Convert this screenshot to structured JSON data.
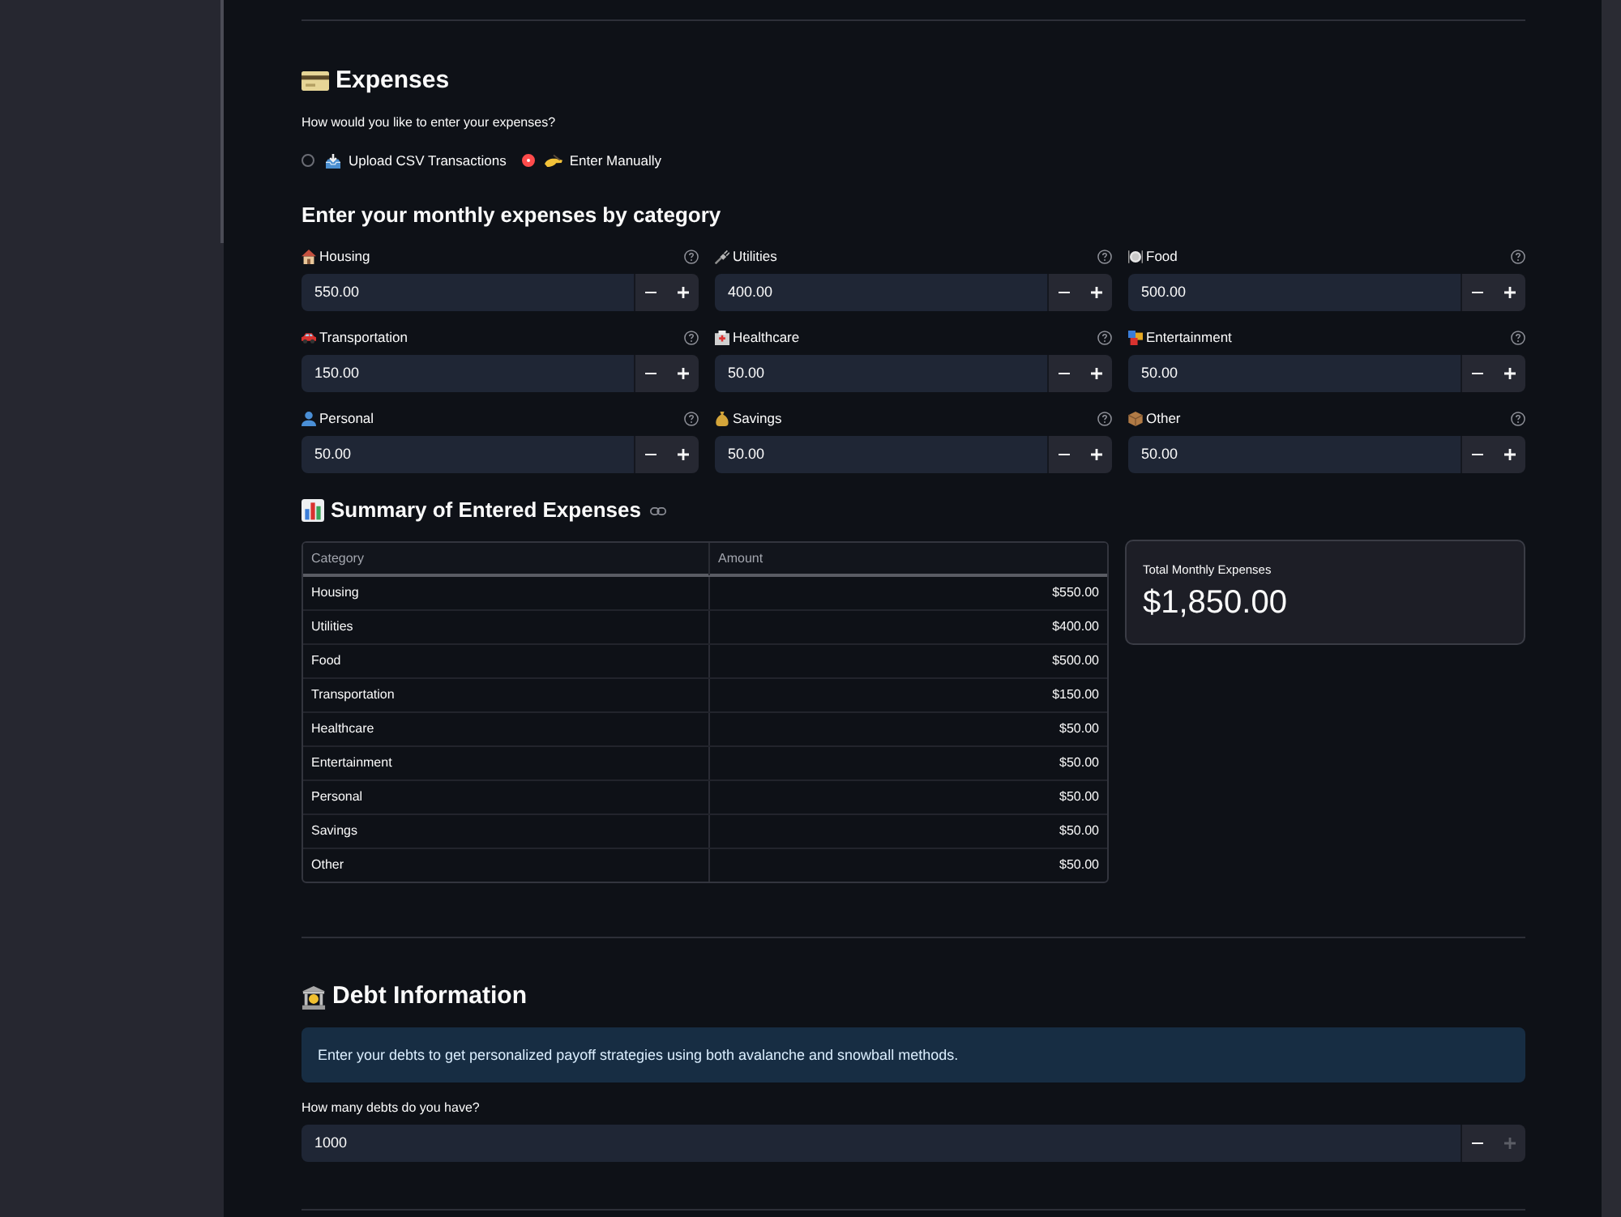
{
  "expense_entry": {
    "title": "Expenses",
    "question": "How would you like to enter your expenses?",
    "options": [
      {
        "label": "Upload CSV Transactions",
        "selected": false
      },
      {
        "label": "Enter Manually",
        "selected": true
      }
    ]
  },
  "category_inputs": {
    "title": "Enter your monthly expenses by category",
    "fields": [
      {
        "label": "Housing",
        "value": "550.00"
      },
      {
        "label": "Utilities",
        "value": "400.00"
      },
      {
        "label": "Food",
        "value": "500.00"
      },
      {
        "label": "Transportation",
        "value": "150.00"
      },
      {
        "label": "Healthcare",
        "value": "50.00"
      },
      {
        "label": "Entertainment",
        "value": "50.00"
      },
      {
        "label": "Personal",
        "value": "50.00"
      },
      {
        "label": "Savings",
        "value": "50.00"
      },
      {
        "label": "Other",
        "value": "50.00"
      }
    ]
  },
  "summary": {
    "title": "Summary of Entered Expenses",
    "table": {
      "columns": [
        "Category",
        "Amount"
      ],
      "rows": [
        [
          "Housing",
          "$550.00"
        ],
        [
          "Utilities",
          "$400.00"
        ],
        [
          "Food",
          "$500.00"
        ],
        [
          "Transportation",
          "$150.00"
        ],
        [
          "Healthcare",
          "$50.00"
        ],
        [
          "Entertainment",
          "$50.00"
        ],
        [
          "Personal",
          "$50.00"
        ],
        [
          "Savings",
          "$50.00"
        ],
        [
          "Other",
          "$50.00"
        ]
      ]
    },
    "metric": {
      "label": "Total Monthly Expenses",
      "value": "$1,850.00"
    }
  },
  "debt_section": {
    "title": "Debt Information",
    "info": "Enter your debts to get personalized payoff strategies using both avalanche and snowball methods.",
    "count_input": {
      "label": "How many debts do you have?",
      "value": "1000",
      "minus_disabled": false,
      "plus_disabled": true
    }
  }
}
